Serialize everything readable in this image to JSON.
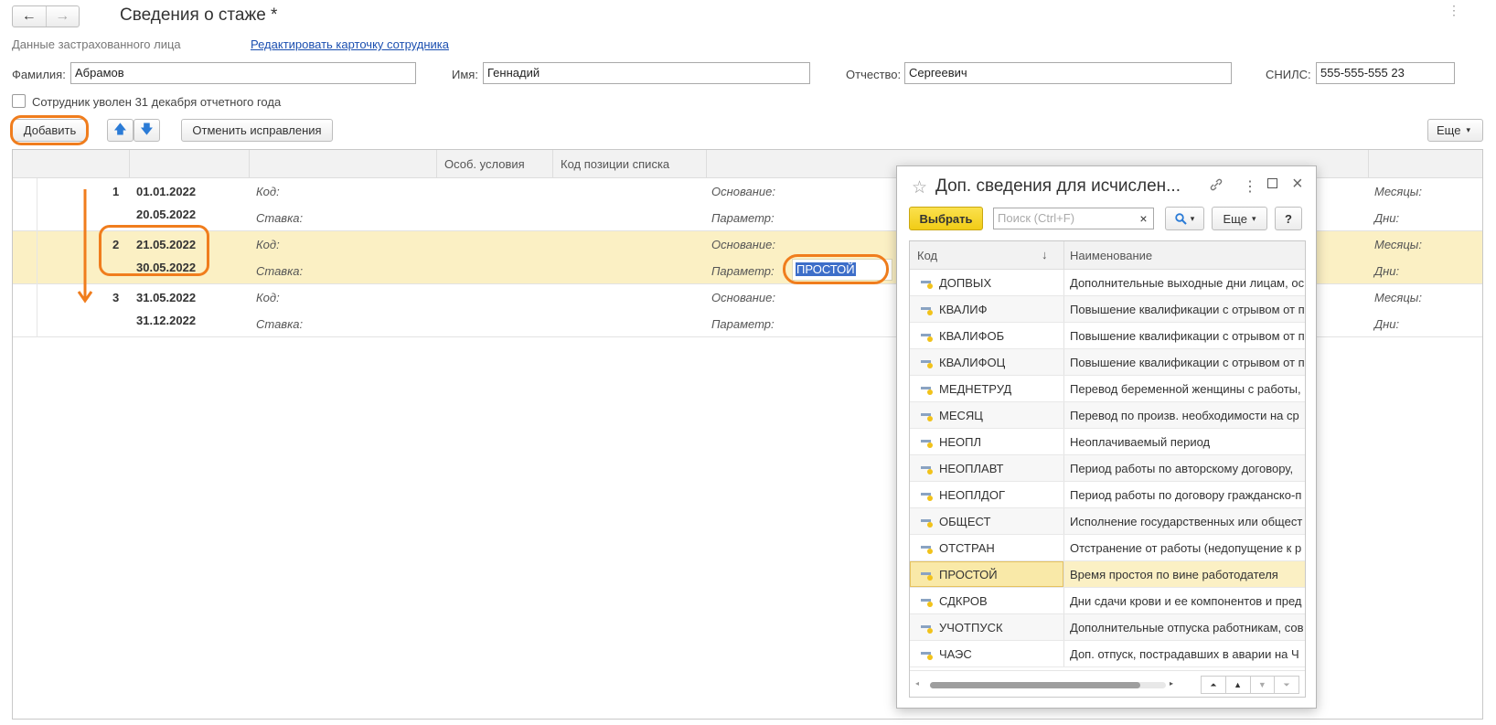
{
  "window": {
    "title": "Сведения о стаже *",
    "back_icon": "←",
    "forward_icon": "→",
    "menu_icon": "⋮"
  },
  "header": {
    "section_label": "Данные застрахованного лица",
    "edit_link": "Редактировать карточку сотрудника"
  },
  "person": {
    "surname_label": "Фамилия:",
    "surname": "Абрамов",
    "name_label": "Имя:",
    "name": "Геннадий",
    "patronymic_label": "Отчество:",
    "patronymic": "Сергеевич",
    "snils_label": "СНИЛС:",
    "snils": "555-555-555 23",
    "dismissed_label": "Сотрудник уволен 31 декабря отчетного года"
  },
  "toolbar": {
    "add": "Добавить",
    "up_icon": "🡅",
    "down_icon": "🡇",
    "cancel_corrections": "Отменить исправления",
    "more": "Еще"
  },
  "grid": {
    "columns": [
      "Особ. условия",
      "Код позиции списка"
    ],
    "field_labels": {
      "code": "Код:",
      "rate": "Ставка:",
      "basis": "Основание:",
      "param": "Параметр:",
      "months": "Месяцы:",
      "days": "Дни:"
    },
    "rows": [
      {
        "num": "1",
        "start": "01.01.2022",
        "end": "20.05.2022",
        "param_value": ""
      },
      {
        "num": "2",
        "start": "21.05.2022",
        "end": "30.05.2022",
        "param_value": "ПРОСТОЙ"
      },
      {
        "num": "3",
        "start": "31.05.2022",
        "end": "31.12.2022",
        "param_value": ""
      }
    ]
  },
  "dialog": {
    "title": "Доп. сведения для исчислен...",
    "select_button": "Выбрать",
    "search_placeholder": "Поиск (Ctrl+F)",
    "clear_icon": "×",
    "more": "Еще",
    "help": "?",
    "col_code": "Код",
    "col_name": "Наименование",
    "sort_icon": "↓",
    "items": [
      {
        "code": "ДОПВЫХ",
        "name": "Дополнительные выходные дни лицам, ос"
      },
      {
        "code": "КВАЛИФ",
        "name": "Повышение квалификации с отрывом от п"
      },
      {
        "code": "КВАЛИФОБ",
        "name": "Повышение квалификации с отрывом от п"
      },
      {
        "code": "КВАЛИФОЦ",
        "name": "Повышение квалификации с отрывом от п"
      },
      {
        "code": "МЕДНЕТРУД",
        "name": "Перевод беременной женщины с работы,"
      },
      {
        "code": "МЕСЯЦ",
        "name": "Перевод по произв. необходимости на ср"
      },
      {
        "code": "НЕОПЛ",
        "name": "Неоплачиваемый период"
      },
      {
        "code": "НЕОПЛАВТ",
        "name": "Период работы по авторскому договору, "
      },
      {
        "code": "НЕОПЛДОГ",
        "name": "Период работы по договору гражданско-п"
      },
      {
        "code": "ОБЩЕСТ",
        "name": "Исполнение государственных или общест"
      },
      {
        "code": "ОТСТРАН",
        "name": "Отстранение от работы (недопущение к р"
      },
      {
        "code": "ПРОСТОЙ",
        "name": "Время простоя по вине работодателя"
      },
      {
        "code": "СДКРОВ",
        "name": "Дни сдачи крови и ее компонентов и пред"
      },
      {
        "code": "УЧОТПУСК",
        "name": "Дополнительные отпуска работникам, сов"
      },
      {
        "code": "ЧАЭС",
        "name": "Доп. отпуск, пострадавших в аварии на Ч"
      }
    ],
    "current_index": 11
  },
  "colors": {
    "accent_orange": "#f07d1d",
    "selection_yellow": "#fbf0c4",
    "primary_button": "#f5d426",
    "link_blue": "#1b4fb0"
  }
}
